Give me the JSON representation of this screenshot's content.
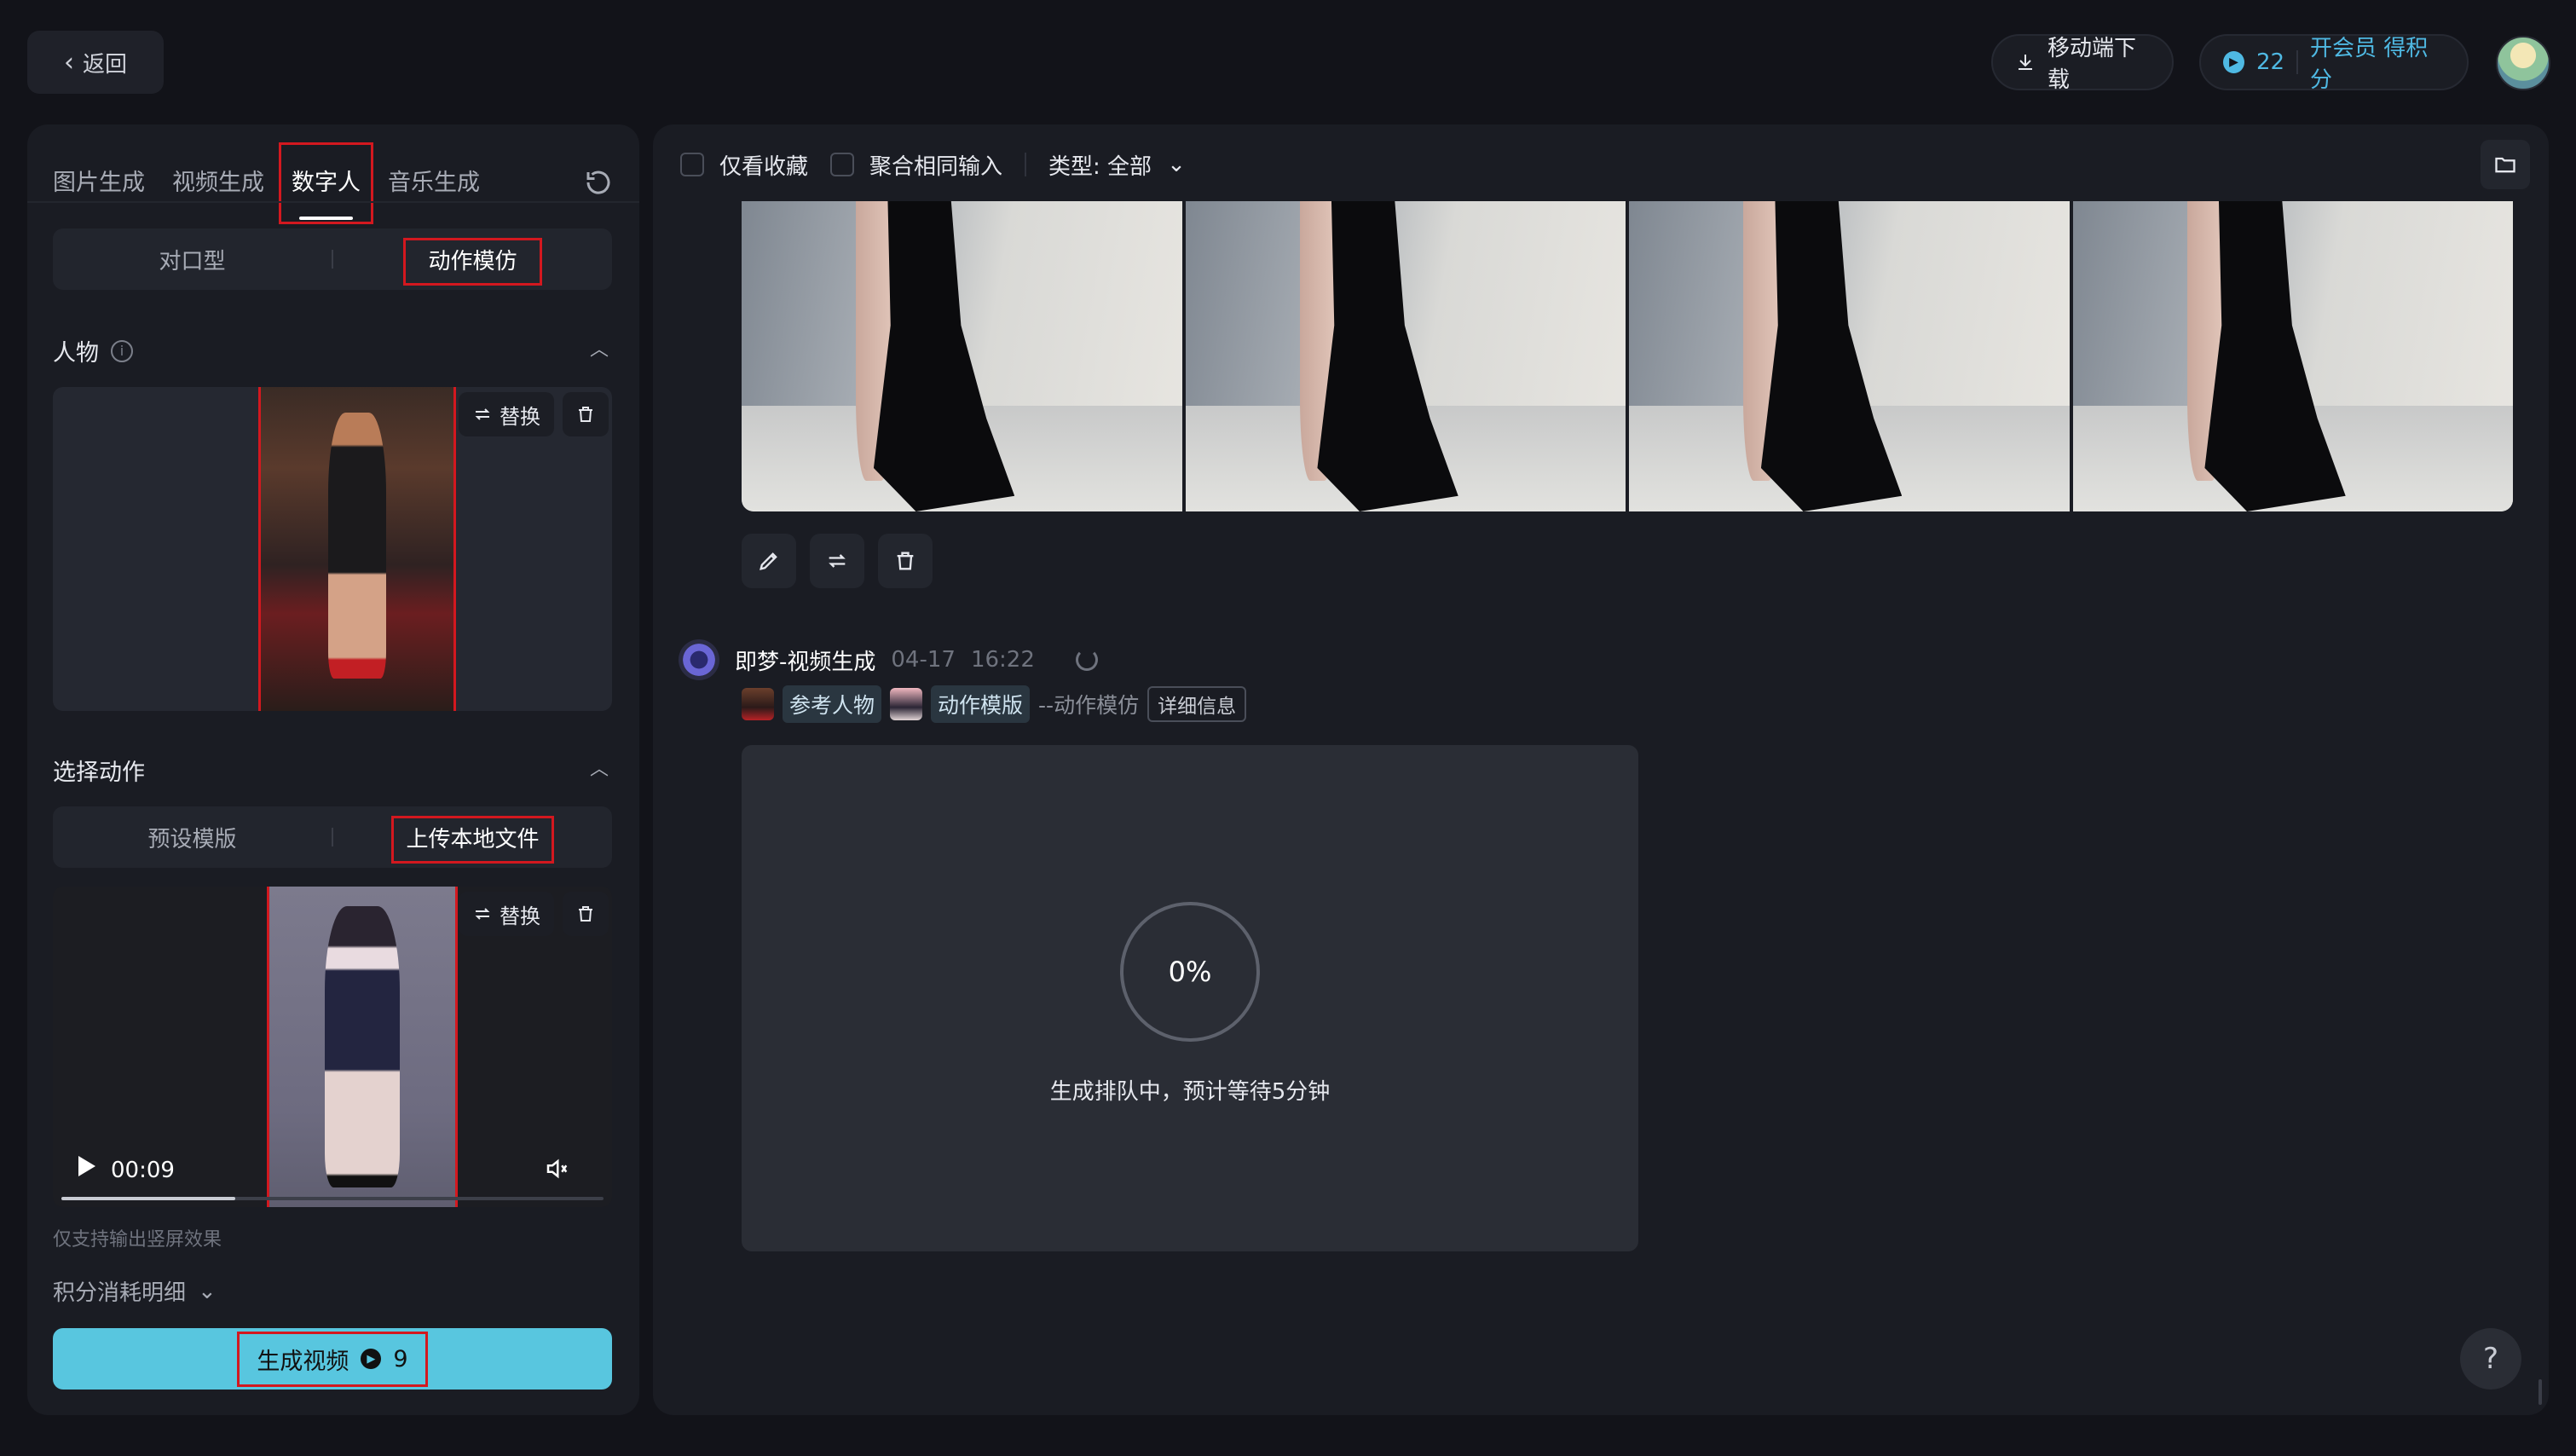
{
  "header": {
    "back_label": "返回",
    "download_label": "移动端下载",
    "credits_count": "22",
    "vip_label": "开会员 得积分"
  },
  "left": {
    "tabs": [
      {
        "label": "图片生成"
      },
      {
        "label": "视频生成"
      },
      {
        "label": "数字人"
      },
      {
        "label": "音乐生成"
      }
    ],
    "mode_options": [
      {
        "label": "对口型"
      },
      {
        "label": "动作模仿"
      }
    ],
    "character_title": "人物",
    "replace_label": "替换",
    "action_title": "选择动作",
    "action_options": [
      {
        "label": "预设模版"
      },
      {
        "label": "上传本地文件"
      }
    ],
    "video_time": "00:09",
    "video_progress": 0.32,
    "hint": "仅支持输出竖屏效果",
    "cost_label": "积分消耗明细",
    "generate_label": "生成视频",
    "generate_cost": "9"
  },
  "right": {
    "filters": {
      "favorites_label": "仅看收藏",
      "merge_label": "聚合相同输入",
      "type_label": "类型: 全部"
    },
    "job": {
      "title": "即梦-视频生成",
      "date": "04-17",
      "time": "16:22",
      "tag_person": "参考人物",
      "tag_template": "动作模版",
      "mode": "--动作模仿",
      "detail_label": "详细信息",
      "progress_text": "0%",
      "queue_text": "生成排队中，预计等待5分钟"
    }
  },
  "help_label": "?",
  "colors": {
    "accent": "#58c6df",
    "highlight": "#d3181f",
    "panel": "#1a1c23"
  }
}
